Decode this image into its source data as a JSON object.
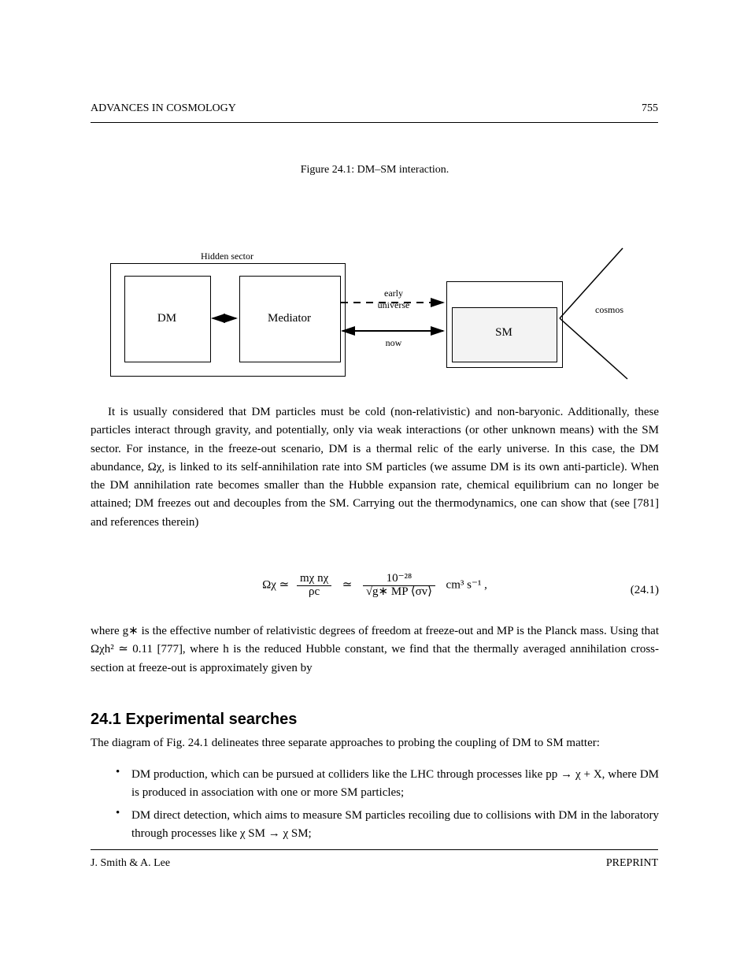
{
  "header": {
    "left": "ADVANCES IN COSMOLOGY",
    "right": "755"
  },
  "figure": {
    "caption": "Figure 24.1: DM–SM interaction.",
    "boxes": {
      "hidden_sector": "Hidden sector",
      "dm": "DM",
      "mediator": "Mediator",
      "sm": "SM",
      "early": "early\nuniverse",
      "now": "now",
      "cosmos": "cosmos"
    }
  },
  "paragraphs": {
    "p1": "It is usually considered that DM particles must be cold (non-relativistic) and non-baryonic. Additionally, these particles interact through gravity, and potentially, only via weak interactions (or other unknown means) with the SM sector. For instance, in the freeze-out scenario, DM is a thermal relic of the early universe. In this case, the DM abundance, Ωχ, is linked to its self-annihilation rate into SM particles (we assume DM is its own anti-particle). When the DM annihilation rate becomes smaller than the Hubble expansion rate, chemical equilibrium can no longer be attained; DM freezes out and decouples from the SM. Carrying out the thermodynamics, one can show that (see [781] and references therein)",
    "eq": "where g∗ is the effective number of relativistic degrees of freedom at freeze-out and MP is the Planck mass. Using that Ωχh² ≃ 0.11 [777], where h is the reduced Hubble constant, we find that the thermally averaged annihilation cross-section at freeze-out is approximately given by",
    "num": "(24.1)",
    "formula_left": "Ωχ ≃",
    "formula_mid": "mχ nχ",
    "formula_bot": "ρc",
    "formula_r": "10⁻²⁸",
    "formula_rbot": "√g∗  MP ⟨σv⟩",
    "formula_unit": "cm³ s⁻¹ ,"
  },
  "section": "24.1 Experimental searches",
  "section_intro": "The diagram of Fig. 24.1 delineates three separate approaches to probing the coupling of DM to SM matter:",
  "bullets": [
    "DM production, which can be pursued at colliders like the LHC through processes like pp → χ + X, where DM is produced in association with one or more SM particles;",
    "DM direct detection, which aims to measure SM particles recoiling due to collisions with DM in the laboratory through processes like χ SM → χ SM;"
  ],
  "footer": {
    "left": "J. Smith & A. Lee",
    "right": "PREPRINT"
  }
}
